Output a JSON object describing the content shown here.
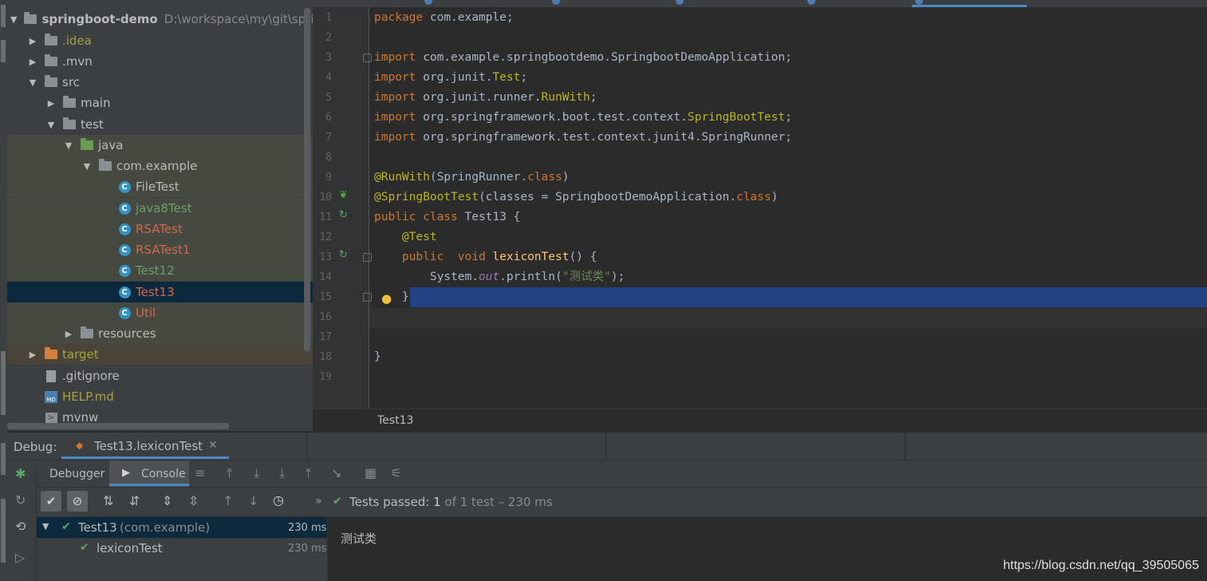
{
  "project_tree": {
    "root_name": "springboot-demo",
    "root_path": "D:\\workspace\\my\\git\\sprin",
    "items": [
      {
        "label": ".idea"
      },
      {
        "label": ".mvn"
      },
      {
        "label": "src"
      },
      {
        "label": "main"
      },
      {
        "label": "test"
      },
      {
        "label": "java"
      },
      {
        "label": "com.example"
      },
      {
        "label": "FileTest"
      },
      {
        "label": "java8Test"
      },
      {
        "label": "RSATest"
      },
      {
        "label": "RSATest1"
      },
      {
        "label": "Test12"
      },
      {
        "label": "Test13"
      },
      {
        "label": "Util"
      },
      {
        "label": "resources"
      },
      {
        "label": "target"
      },
      {
        "label": ".gitignore"
      },
      {
        "label": "HELP.md"
      },
      {
        "label": "mvnw"
      }
    ]
  },
  "editor": {
    "line_numbers": [
      "1",
      "2",
      "3",
      "4",
      "5",
      "6",
      "7",
      "8",
      "9",
      "10",
      "11",
      "12",
      "13",
      "14",
      "15",
      "16",
      "17",
      "18",
      "19"
    ],
    "code": {
      "l1_kw": "package",
      "l1_rest": " com.example;",
      "l3_kw": "import",
      "l3_rest": " com.example.springbootdemo.SpringbootDemoApplication;",
      "l4_kw": "import",
      "l4_a": " org.junit.",
      "l4_b": "Test",
      "l4_c": ";",
      "l5_kw": "import",
      "l5_a": " org.junit.runner.",
      "l5_b": "RunWith",
      "l5_c": ";",
      "l6_kw": "import",
      "l6_a": " org.springframework.boot.test.context.",
      "l6_b": "SpringBootTest",
      "l6_c": ";",
      "l7_kw": "import",
      "l7_rest": " org.springframework.test.context.junit4.SpringRunner;",
      "l9_ann": "@RunWith",
      "l9_a": "(SpringRunner.",
      "l9_kw": "class",
      "l9_b": ")",
      "l10_ann": "@SpringBootTest",
      "l10_a": "(classes = SpringbootDemoApplication.",
      "l10_kw": "class",
      "l10_b": ")",
      "l11_kw": "public class",
      "l11_rest": " Test13 {",
      "l12_ann": "@Test",
      "l13_kw": "public  void",
      "l13_fn": " lexiconTest",
      "l13_rest": "() {",
      "l14_a": "System.",
      "l14_fld": "out",
      "l14_b": ".println(",
      "l14_str": "\"测试类\"",
      "l14_c": ");",
      "l15": "}",
      "l18": "}"
    },
    "breadcrumb": "Test13"
  },
  "debug": {
    "title": "Debug:",
    "session_tab": "Test13.lexiconTest",
    "tab_debugger": "Debugger",
    "tab_console": "Console",
    "status_prefix": "Tests passed:",
    "status_count": "1",
    "status_rest": "of 1 test – 230 ms",
    "results": [
      {
        "name": "Test13",
        "pkg": "(com.example)",
        "time": "230 ms"
      },
      {
        "name": "lexiconTest",
        "time": "230 ms"
      }
    ],
    "console_output": "测试类"
  },
  "watermark": "https://blog.csdn.net/qq_39505065",
  "icons": [
    "folder-icon",
    "java-class-icon",
    "spring-leaf-icon",
    "run-test-icon",
    "bulb-icon",
    "bug-icon",
    "check-icon",
    "stop-icon",
    "sort-icon",
    "rerun-icon",
    "step-over-icon",
    "step-into-icon",
    "step-out-icon",
    "table-icon",
    "clock-icon",
    "close-icon"
  ]
}
